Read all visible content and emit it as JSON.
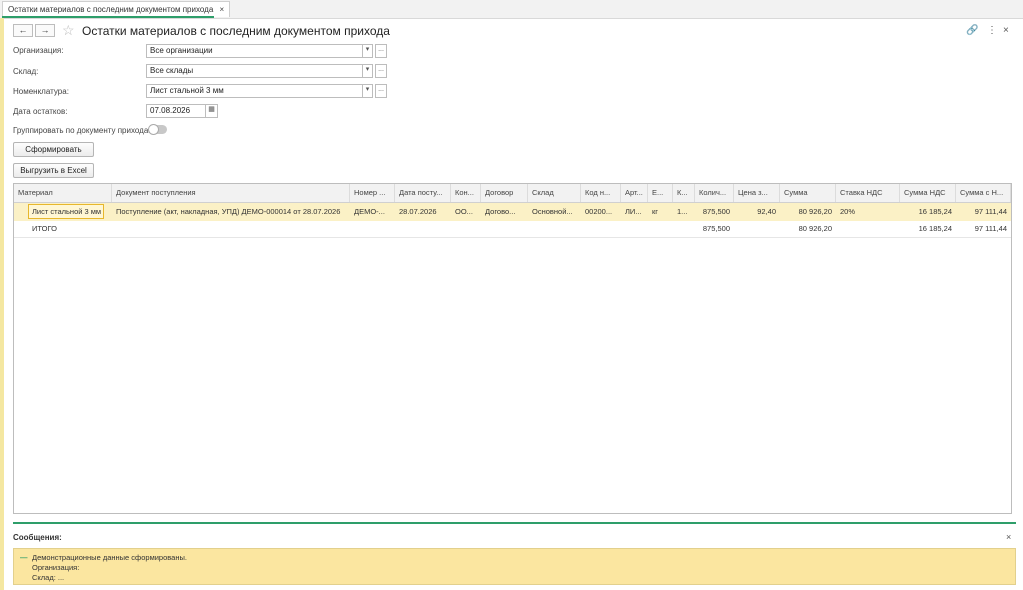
{
  "tab": {
    "title": "Остатки материалов с последним документом прихода",
    "close": "×"
  },
  "nav": {
    "back": "←",
    "forward": "→",
    "star": "☆"
  },
  "page_title": "Остатки материалов с последним документом прихода",
  "top_icons": {
    "link": "🔗",
    "more": "⋮",
    "close": "×"
  },
  "filters": {
    "org_label": "Организация:",
    "org_value": "Все организации",
    "warehouse_label": "Склад:",
    "warehouse_value": "Все склады",
    "nomenclature_label": "Номенклатура:",
    "nomenclature_value": "Лист стальной 3 мм",
    "date_label": "Дата остатков:",
    "date_value": "07.08.2026",
    "group_label": "Группировать по документу прихода:",
    "dropdown": "▾",
    "dots": "...",
    "calendar": "▦"
  },
  "buttons": {
    "generate": "Сформировать",
    "export": "Выгрузить в Excel"
  },
  "table": {
    "headers": [
      "Материал",
      "Документ поступления",
      "Номер ...",
      "Дата посту...",
      "Кон...",
      "Договор",
      "Склад",
      "Код н...",
      "Арт...",
      "Е...",
      "К...",
      "Колич...",
      "Цена з...",
      "Сумма",
      "Ставка НДС",
      "Сумма НДС",
      "Сумма с Н..."
    ],
    "row1": [
      "Лист стальной 3 мм",
      "Поступление (акт, накладная, УПД) ДЕМО-000014 от 28.07.2026",
      "ДЕМО-...",
      "28.07.2026",
      "ОО...",
      "Догово...",
      "Основной...",
      "00200...",
      "ЛИ...",
      "кг",
      "1...",
      "875,500",
      "92,40",
      "80 926,20",
      "20%",
      "16 185,24",
      "97 111,44"
    ],
    "total": {
      "label": "ИТОГО",
      "qty": "875,500",
      "sum": "80 926,20",
      "vat": "16 185,24",
      "sum_vat": "97 111,44"
    }
  },
  "messages": {
    "title": "Сообщения:",
    "close": "×",
    "dash": "—",
    "line1": "Демонстрационные данные сформированы.",
    "line2": "Организация:",
    "line3": "Склад: ..."
  },
  "colors": {
    "accent": "#2e9e6a",
    "highlight": "#fbf1c6",
    "message_bg": "#fbe6a0"
  }
}
